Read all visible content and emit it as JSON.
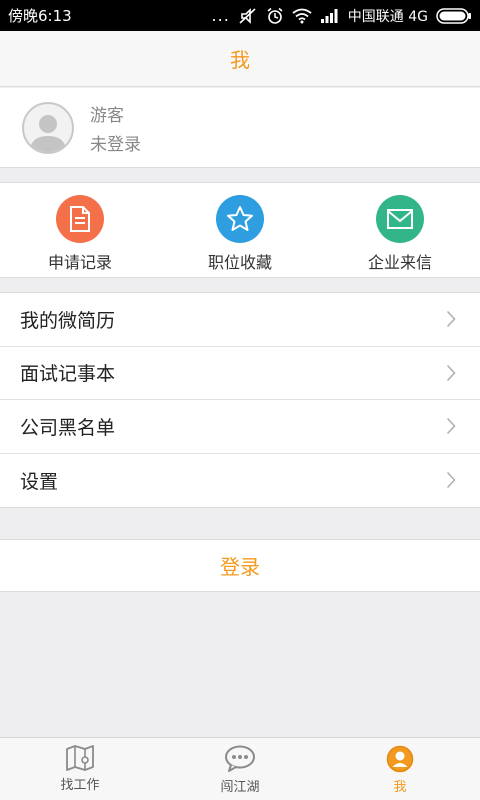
{
  "status_bar": {
    "time": "傍晚6:13",
    "carrier": "中国联通 4G",
    "more_dots": "..."
  },
  "header": {
    "title": "我"
  },
  "profile": {
    "name": "游客",
    "state": "未登录"
  },
  "quick_actions": [
    {
      "label": "申请记录",
      "icon": "document-icon",
      "color": "#f37048"
    },
    {
      "label": "职位收藏",
      "icon": "star-icon",
      "color": "#2e9ee0"
    },
    {
      "label": "企业来信",
      "icon": "envelope-icon",
      "color": "#33b58a"
    }
  ],
  "menu": [
    {
      "label": "我的微简历"
    },
    {
      "label": "面试记事本"
    },
    {
      "label": "公司黑名单"
    },
    {
      "label": "设置"
    }
  ],
  "login": {
    "label": "登录"
  },
  "tabs": [
    {
      "label": "找工作",
      "icon": "map-icon",
      "active": false
    },
    {
      "label": "闯江湖",
      "icon": "chat-bubble-icon",
      "active": false
    },
    {
      "label": "我",
      "icon": "user-icon",
      "active": true
    }
  ],
  "colors": {
    "accent": "#f39a1e"
  }
}
